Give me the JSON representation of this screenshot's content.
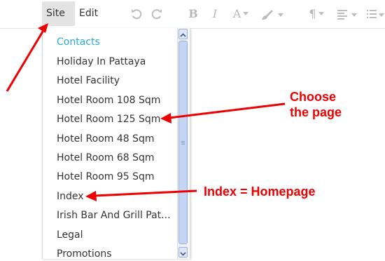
{
  "toolbar": {
    "site_label": "Site",
    "edit_label": "Edit",
    "icons": [
      "undo-icon",
      "redo-icon",
      "bold-icon",
      "italic-icon",
      "font-color-icon",
      "brush-icon",
      "paragraph-icon",
      "align-icon",
      "list-icon"
    ]
  },
  "dropdown": {
    "items": [
      {
        "label": "Contacts",
        "state": "highlighted"
      },
      {
        "label": "Holiday In Pattaya"
      },
      {
        "label": "Hotel Facility"
      },
      {
        "label": "Hotel Room 108 Sqm"
      },
      {
        "label": "Hotel Room 125 Sqm"
      },
      {
        "label": "Hotel Room 48 Sqm"
      },
      {
        "label": "Hotel Room 68 Sqm"
      },
      {
        "label": "Hotel Room 95 Sqm"
      },
      {
        "label": "Index"
      },
      {
        "label": "Irish Bar And Grill Pat..."
      },
      {
        "label": "Legal"
      },
      {
        "label": "Promotions"
      }
    ]
  },
  "annotations": {
    "choose_page_line1": "Choose",
    "choose_page_line2": "the page",
    "index_note": "Index = Homepage"
  },
  "colors": {
    "annotation_red": "#ee0000",
    "highlight_blue": "#2aabd2",
    "scrollbar_thumb": "#c3d4f4"
  }
}
